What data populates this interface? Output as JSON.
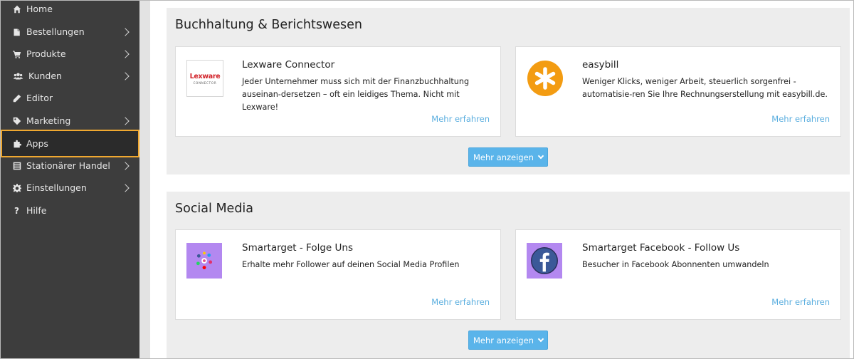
{
  "sidebar": {
    "items": [
      {
        "label": "Home",
        "icon": "home-icon",
        "has_submenu": false
      },
      {
        "label": "Bestellungen",
        "icon": "orders-icon",
        "has_submenu": true
      },
      {
        "label": "Produkte",
        "icon": "cart-icon",
        "has_submenu": true
      },
      {
        "label": "Kunden",
        "icon": "users-icon",
        "has_submenu": true
      },
      {
        "label": "Editor",
        "icon": "pencil-icon",
        "has_submenu": false
      },
      {
        "label": "Marketing",
        "icon": "tag-icon",
        "has_submenu": true
      },
      {
        "label": "Apps",
        "icon": "puzzle-icon",
        "has_submenu": false,
        "active": true
      },
      {
        "label": "Stationärer Handel",
        "icon": "store-icon",
        "has_submenu": true
      },
      {
        "label": "Einstellungen",
        "icon": "gear-icon",
        "has_submenu": true
      },
      {
        "label": "Hilfe",
        "icon": "question-icon",
        "has_submenu": false
      }
    ]
  },
  "sections": [
    {
      "title": "Buchhaltung & Berichtswesen",
      "cards": [
        {
          "title": "Lexware Connector",
          "logo_text": "Lexware",
          "logo_subtext": "CONNECTOR",
          "desc": "Jeder Unternehmer muss sich mit der Finanzbuchhaltung auseinan-dersetzen – oft ein leidiges Thema. Nicht mit Lexware!",
          "more": "Mehr erfahren"
        },
        {
          "title": "easybill",
          "desc": "Weniger Klicks, weniger Arbeit, steuerlich sorgenfrei - automatisie-ren Sie Ihre Rechnungserstellung mit easybill.de.",
          "more": "Mehr erfahren"
        }
      ],
      "more_button": "Mehr anzeigen"
    },
    {
      "title": "Social Media",
      "cards": [
        {
          "title": "Smartarget - Folge Uns",
          "desc": "Erhalte mehr Follower auf deinen Social Media Profilen",
          "more": "Mehr erfahren"
        },
        {
          "title": "Smartarget Facebook - Follow Us",
          "desc": "Besucher in Facebook Abonnenten umwandeln",
          "more": "Mehr erfahren"
        }
      ],
      "more_button": "Mehr anzeigen"
    }
  ],
  "colors": {
    "sidebar_bg": "#3d3d3d",
    "active_border": "#f0a830",
    "link": "#5aaedf",
    "button": "#5ab4ea",
    "easybill_orange": "#f39c12",
    "lexware_red": "#d2232a",
    "smartarget_purple": "#b388f0"
  }
}
